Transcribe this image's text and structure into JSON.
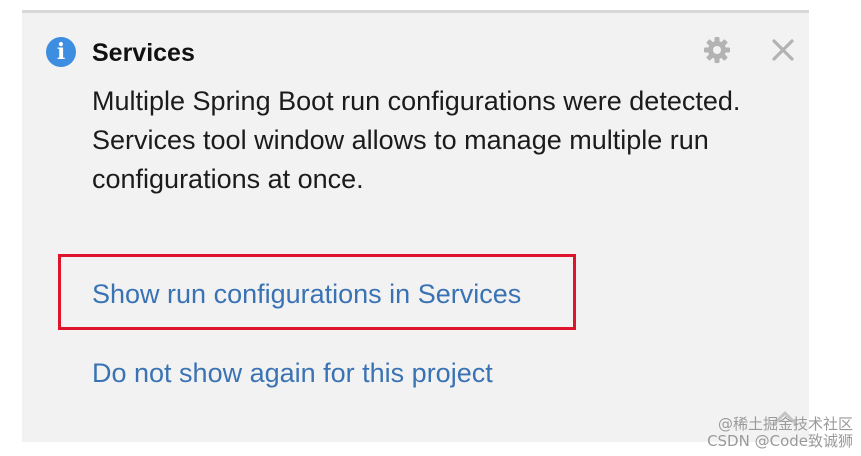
{
  "notification": {
    "title": "Services",
    "message_lines": [
      "Multiple Spring Boot run configurations were detected.",
      "Services tool window allows to manage multiple run configurations at once."
    ],
    "actions": {
      "show_services": "Show run configurations in Services",
      "dont_show": "Do not show again for this project"
    },
    "icons": {
      "info": "info-icon",
      "settings": "gear-icon",
      "close": "close-icon",
      "collapse": "chevron-up-icon"
    },
    "info_glyph": "i"
  },
  "watermark": {
    "line1": "@稀土掘金技术社区",
    "line2": "CSDN @Code致诚狮"
  },
  "colors": {
    "panel_bg": "#f2f2f2",
    "link": "#3a73b4",
    "info": "#3d8ee0",
    "highlight": "#e0142b",
    "icon_gray": "#b3b3b3"
  }
}
